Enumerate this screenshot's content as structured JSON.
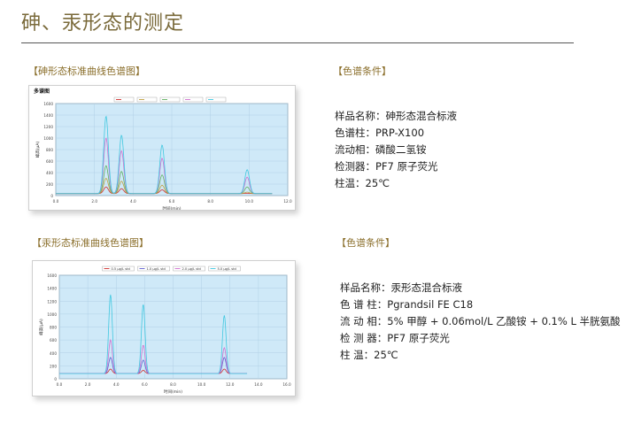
{
  "page": {
    "title": "砷、汞形态的测定"
  },
  "arsenic": {
    "chart_label": "【砷形态标准曲线色谱图】",
    "conditions_label": "【色谱条件】",
    "conditions": [
      "样品名称：砷形态混合标液",
      "色谱柱：PRP-X100",
      "流动相：磷酸二氢铵",
      "检测器：PF7 原子荧光",
      "柱温：25℃"
    ]
  },
  "mercury": {
    "chart_label": "【汞形态标准曲线色谱图】",
    "conditions_label": "【色谱条件】",
    "conditions": [
      "样品名称：汞形态混合标液",
      "色 谱 柱：Pgrandsil FE C18",
      "流 动 相：5% 甲醇 + 0.06mol/L 乙酸铵 + 0.1% L 半胱氨酸",
      "检 测 器：PF7 原子荧光",
      "柱    温：25℃"
    ]
  },
  "chart_data": [
    {
      "type": "line",
      "title": "多谱图",
      "xlabel": "时间(min)",
      "ylabel": "峰高(μA)",
      "xlim": [
        0,
        12
      ],
      "ylim": [
        0,
        1600
      ],
      "x_ticks": [
        "0.0",
        "2.0",
        "4.0",
        "6.0",
        "8.0",
        "10.0",
        "12.0"
      ],
      "y_ticks": [
        "0",
        "200",
        "400",
        "600",
        "800",
        "1000",
        "1200",
        "1400",
        "1600"
      ],
      "legend": "top",
      "grid": true,
      "peak_times": [
        2.6,
        3.4,
        5.5,
        9.9
      ],
      "series": [
        {
          "color": "#d03030",
          "peaks": [
            150,
            120,
            100,
            40
          ]
        },
        {
          "color": "#c0a040",
          "peaks": [
            300,
            250,
            180,
            60
          ]
        },
        {
          "color": "#60b060",
          "peaks": [
            520,
            420,
            360,
            150
          ]
        },
        {
          "color": "#d070d0",
          "peaks": [
            1000,
            780,
            650,
            320
          ]
        },
        {
          "color": "#40c8e0",
          "peaks": [
            1380,
            1050,
            880,
            450
          ]
        }
      ]
    },
    {
      "type": "line",
      "xlabel": "时间(min)",
      "ylabel": "峰高(μA)",
      "xlim": [
        0,
        16
      ],
      "ylim": [
        0,
        1600
      ],
      "x_ticks": [
        "0.0",
        "2.0",
        "4.0",
        "6.0",
        "8.0",
        "10.0",
        "12.0",
        "14.0",
        "16.0"
      ],
      "y_ticks": [
        "0",
        "200",
        "400",
        "600",
        "800",
        "1000",
        "1200",
        "1400",
        "1600"
      ],
      "legend": "top",
      "grid": true,
      "peak_times": [
        3.6,
        5.9,
        11.6
      ],
      "series": [
        {
          "color": "#d03030",
          "legend_label": "0.5 μg/L std",
          "peaks": [
            150,
            130,
            150
          ]
        },
        {
          "color": "#6060d0",
          "legend_label": "1.0 μg/L std",
          "peaks": [
            330,
            290,
            330
          ]
        },
        {
          "color": "#d070d0",
          "legend_label": "2.0 μg/L std",
          "peaks": [
            600,
            520,
            480
          ]
        },
        {
          "color": "#40c8e0",
          "legend_label": "5.0 μg/L std",
          "peaks": [
            1300,
            1150,
            980
          ]
        }
      ]
    }
  ]
}
